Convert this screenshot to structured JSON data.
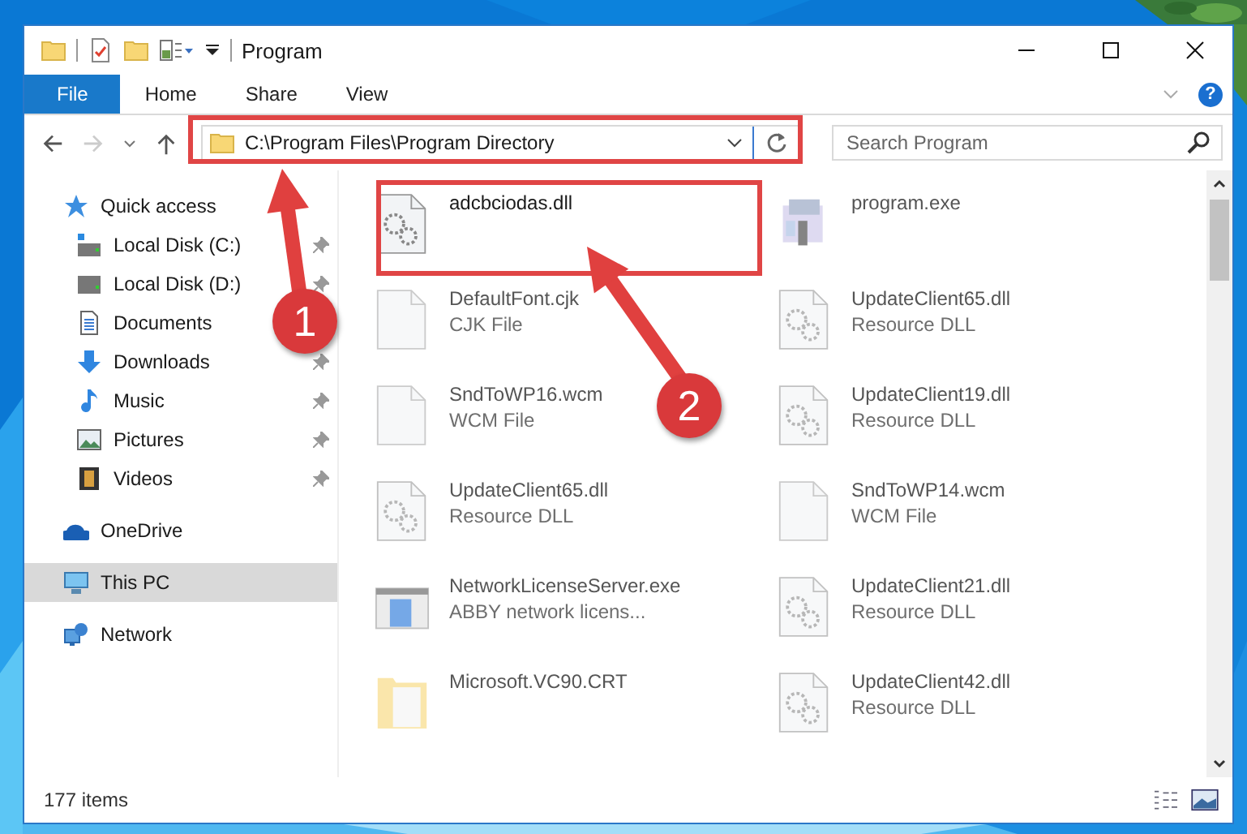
{
  "window": {
    "title": "Program"
  },
  "ribbon": {
    "tabs": [
      {
        "label": "File",
        "selected": true
      },
      {
        "label": "Home",
        "selected": false
      },
      {
        "label": "Share",
        "selected": false
      },
      {
        "label": "View",
        "selected": false
      }
    ],
    "help": "?"
  },
  "address": {
    "path": "C:\\Program Files\\Program Directory"
  },
  "search": {
    "placeholder": "Search Program"
  },
  "sidebar": {
    "items": [
      {
        "label": "Quick access",
        "kind": "star",
        "selected": false,
        "children": [
          {
            "label": "Local Disk (C:)",
            "kind": "disk-c",
            "pinned": true
          },
          {
            "label": "Local Disk (D:)",
            "kind": "disk",
            "pinned": true
          },
          {
            "label": "Documents",
            "kind": "documents",
            "pinned": false
          },
          {
            "label": "Downloads",
            "kind": "downloads",
            "pinned": true
          },
          {
            "label": "Music",
            "kind": "music",
            "pinned": true
          },
          {
            "label": "Pictures",
            "kind": "pictures",
            "pinned": true
          },
          {
            "label": "Videos",
            "kind": "videos",
            "pinned": true
          }
        ]
      },
      {
        "label": "OneDrive",
        "kind": "cloud",
        "selected": false
      },
      {
        "label": "This PC",
        "kind": "pc",
        "selected": true
      },
      {
        "label": "Network",
        "kind": "network",
        "selected": false
      }
    ]
  },
  "files": [
    {
      "name": "adcbciodas.dll",
      "kind": "dll",
      "dimmed": false
    },
    {
      "name": "program.exe",
      "kind": "app",
      "dimmed": true
    },
    {
      "name": "DefaultFont.cjk",
      "type": "CJK File",
      "kind": "blank",
      "dimmed": true
    },
    {
      "name": "UpdateClient65.dll",
      "type": "Resource DLL",
      "kind": "dll",
      "dimmed": true
    },
    {
      "name": "SndToWP16.wcm",
      "type": "WCM File",
      "kind": "blank",
      "dimmed": true
    },
    {
      "name": "UpdateClient19.dll",
      "type": "Resource DLL",
      "kind": "dll",
      "dimmed": true
    },
    {
      "name": "UpdateClient65.dll",
      "type": "Resource DLL",
      "kind": "dll",
      "dimmed": true
    },
    {
      "name": "SndToWP14.wcm",
      "type": "WCM File",
      "kind": "blank",
      "dimmed": true
    },
    {
      "name": "NetworkLicenseServer.exe",
      "type": "ABBY network licens...",
      "kind": "window",
      "dimmed": true
    },
    {
      "name": "UpdateClient21.dll",
      "type": "Resource DLL",
      "kind": "dll",
      "dimmed": true
    },
    {
      "name": "Microsoft.VC90.CRT",
      "kind": "folder",
      "dimmed": true
    },
    {
      "name": "UpdateClient42.dll",
      "type": "Resource DLL",
      "kind": "dll",
      "dimmed": true
    }
  ],
  "callouts": [
    {
      "number": "1"
    },
    {
      "number": "2"
    }
  ],
  "status_bar": {
    "count": "177 items"
  }
}
